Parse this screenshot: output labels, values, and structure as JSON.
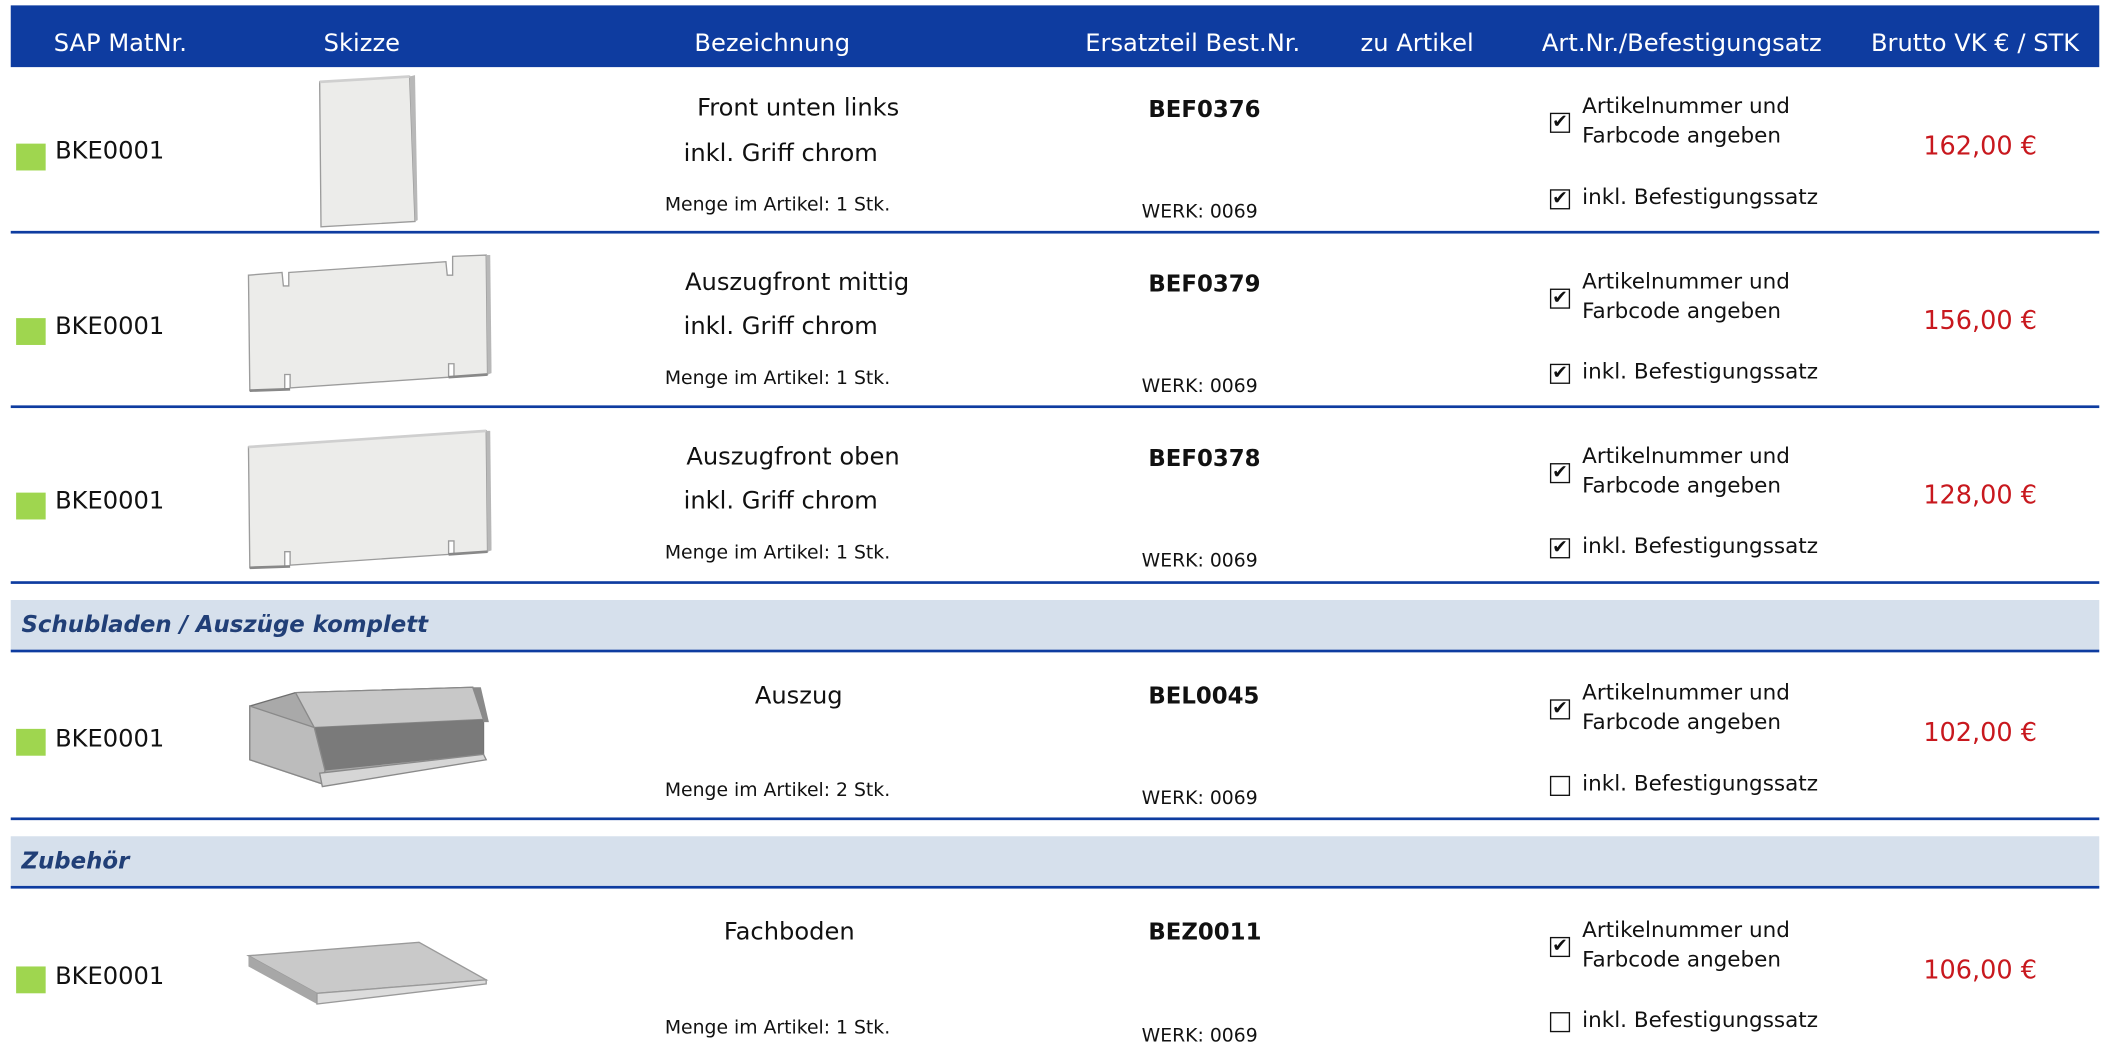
{
  "header": {
    "sap": "SAP MatNr.",
    "skizze": "Skizze",
    "bezeichnung": "Bezeichnung",
    "ersatzteil": "Ersatzteil Best.Nr.",
    "zu_artikel": "zu Artikel",
    "artnr": "Art.Nr./Befestigungsatz",
    "preis": "Brutto VK € / STK"
  },
  "colors": {
    "header_bg": "#0e3ca0",
    "section_bg": "#d6e0ec",
    "status_square": "#9fd64f",
    "price": "#c8181e"
  },
  "rows": [
    {
      "sap": "BKE0001",
      "sketch": "front-panel-tall",
      "desc1": "Front unten links",
      "desc2": "inkl. Griff chrom",
      "menge": "Menge im Artikel: 1 Stk.",
      "best": "BEF0376",
      "werk": "WERK: 0069",
      "check1": "Artikelnummer und\nFarbcode angeben",
      "check1_on": true,
      "check2": "inkl. Befestigungssatz",
      "check2_on": true,
      "price": "162,00 €"
    },
    {
      "sap": "BKE0001",
      "sketch": "drawer-front-notched",
      "desc1": "Auszugfront mittig",
      "desc2": "inkl. Griff chrom",
      "menge": "Menge im Artikel: 1 Stk.",
      "best": "BEF0379",
      "werk": "WERK: 0069",
      "check1": "Artikelnummer und\nFarbcode angeben",
      "check1_on": true,
      "check2": "inkl. Befestigungssatz",
      "check2_on": true,
      "price": "156,00 €"
    },
    {
      "sap": "BKE0001",
      "sketch": "drawer-front-top",
      "desc1": "Auszugfront oben",
      "desc2": "inkl. Griff chrom",
      "menge": "Menge im Artikel: 1 Stk.",
      "best": "BEF0378",
      "werk": "WERK: 0069",
      "check1": "Artikelnummer und\nFarbcode angeben",
      "check1_on": true,
      "check2": "inkl. Befestigungssatz",
      "check2_on": true,
      "price": "128,00 €"
    }
  ],
  "section1": {
    "title": "Schubladen / Auszüge komplett",
    "row": {
      "sap": "BKE0001",
      "sketch": "drawer-box",
      "desc1": "Auszug",
      "menge": "Menge im Artikel: 2 Stk.",
      "best": "BEL0045",
      "werk": "WERK: 0069",
      "check1": "Artikelnummer und\nFarbcode angeben",
      "check1_on": true,
      "check2": "inkl. Befestigungssatz",
      "check2_on": false,
      "price": "102,00 €"
    }
  },
  "section2": {
    "title": "Zubehör",
    "row": {
      "sap": "BKE0001",
      "sketch": "shelf-board",
      "desc1": "Fachboden",
      "menge": "Menge im Artikel: 1 Stk.",
      "best": "BEZ0011",
      "werk": "WERK: 0069",
      "check1": "Artikelnummer und\nFarbcode angeben",
      "check1_on": true,
      "check2": "inkl. Befestigungssatz",
      "check2_on": false,
      "price": "106,00 €"
    }
  }
}
